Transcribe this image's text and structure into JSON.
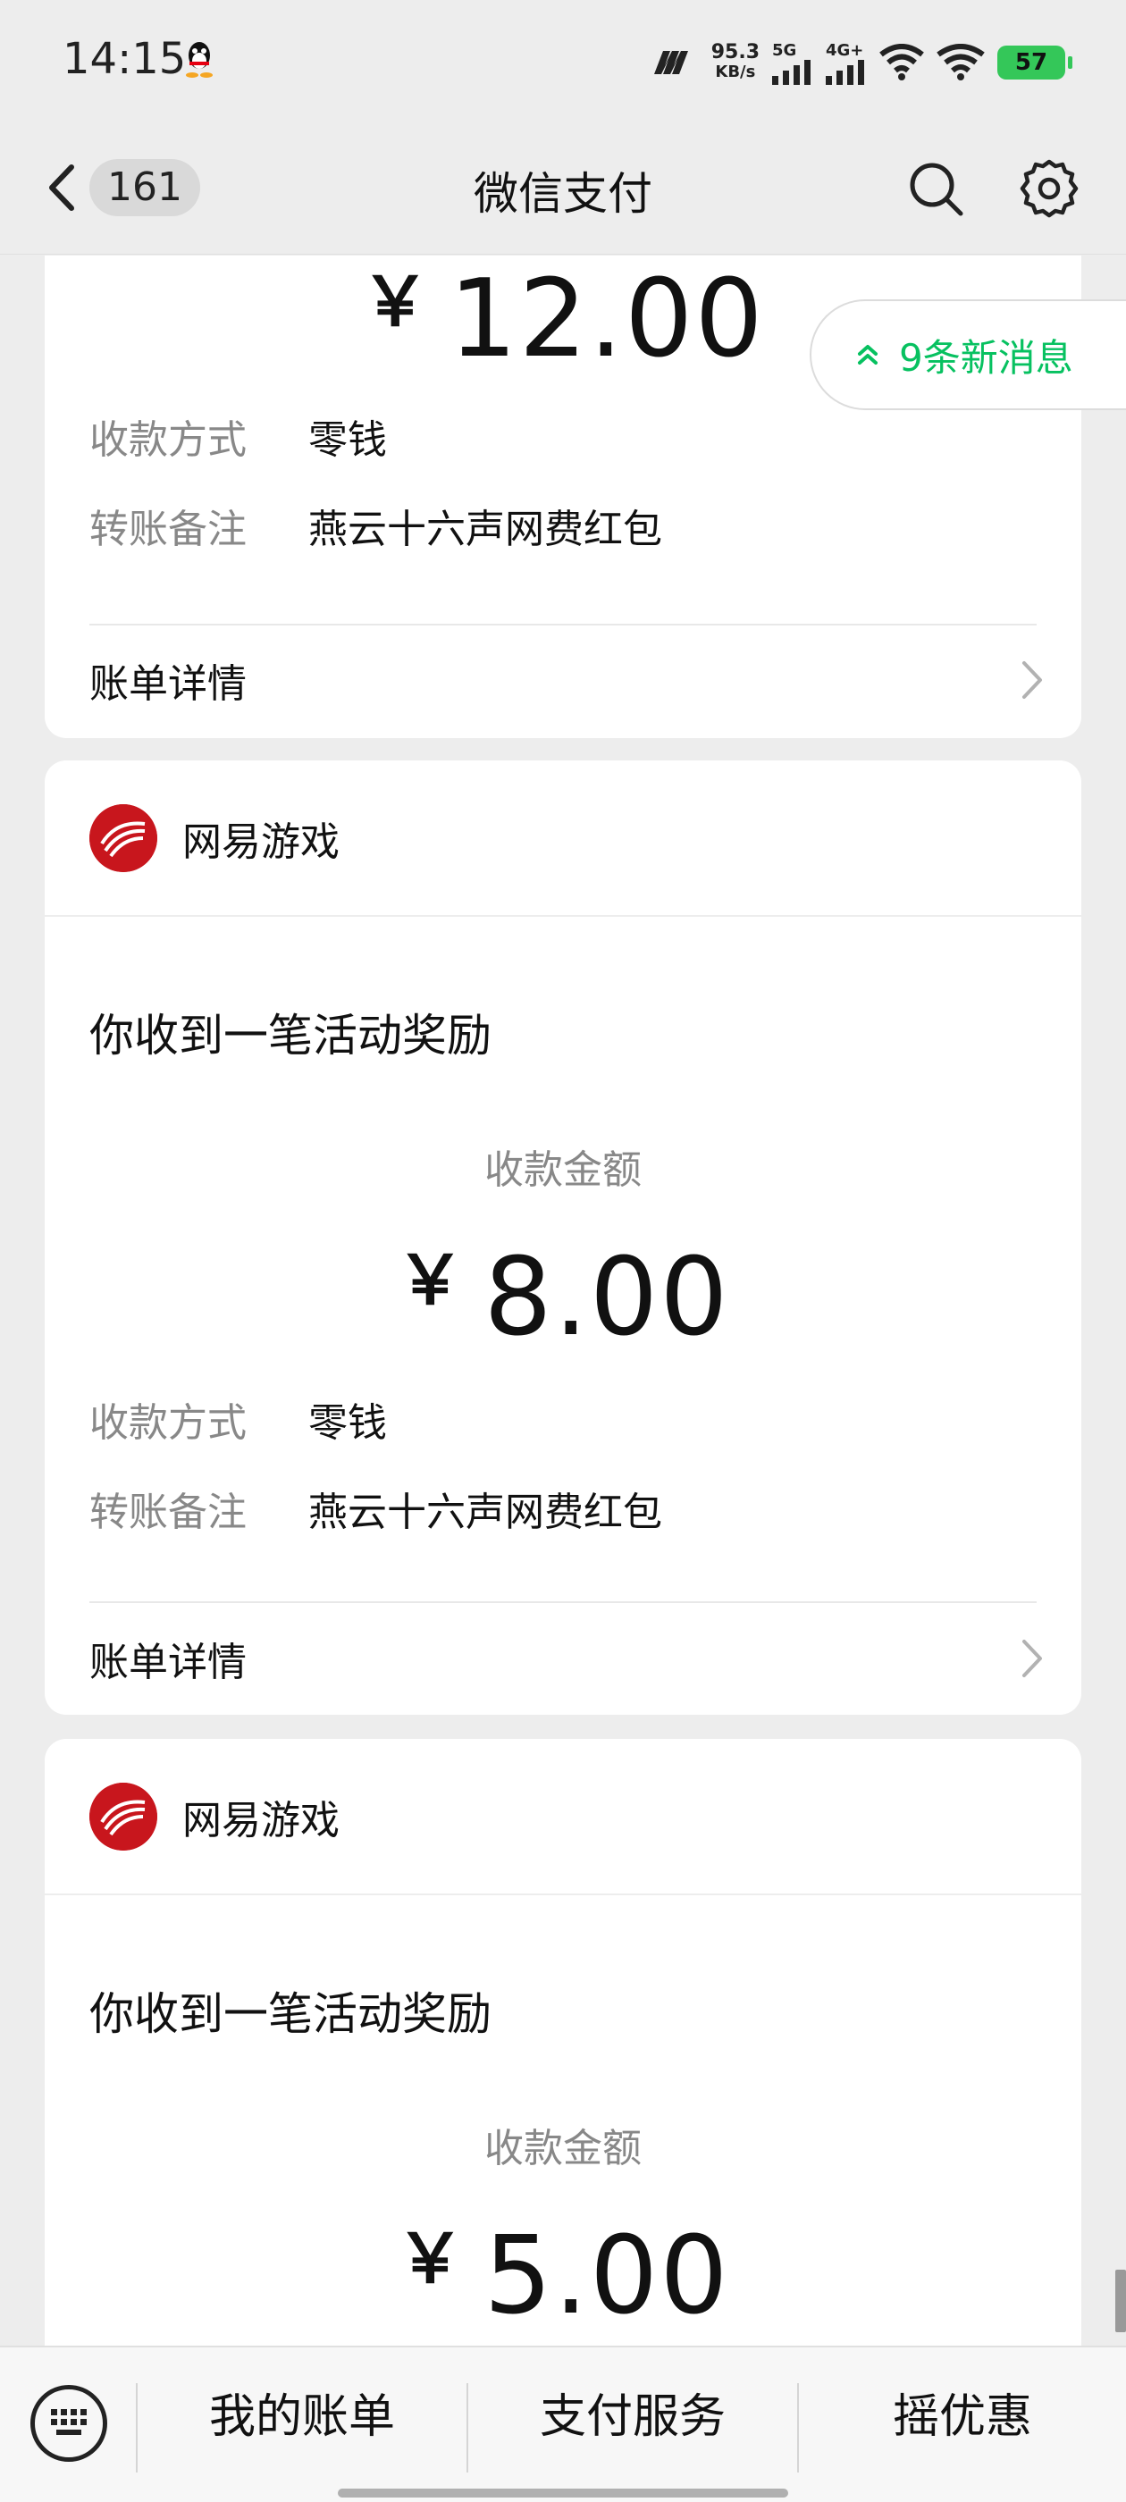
{
  "status_bar": {
    "time": "14:15",
    "net_speed_value": "95.3",
    "net_speed_unit": "KB/s",
    "signal_1_label": "5G",
    "signal_2_label": "4G+",
    "battery": "57",
    "icons": [
      "qq-penguin-icon",
      "m-logo-icon",
      "signal-icon",
      "wifi-icon",
      "battery-icon"
    ]
  },
  "nav": {
    "back_badge": "161",
    "title": "微信支付",
    "icons": [
      "back-chevron-icon",
      "search-icon",
      "gear-icon"
    ]
  },
  "new_messages": {
    "label": "9条新消息",
    "icon": "double-chevron-up-icon"
  },
  "cards": [
    {
      "amount_symbol": "￥",
      "amount_value": "12.00",
      "method_key": "收款方式",
      "method_value": "零钱",
      "remark_key": "转账备注",
      "remark_value": "燕云十六声网费红包",
      "details_label": "账单详情"
    },
    {
      "merchant": "网易游戏",
      "notice": "你收到一笔活动奖励",
      "amount_label": "收款金额",
      "amount_symbol": "￥",
      "amount_value": "8.00",
      "method_key": "收款方式",
      "method_value": "零钱",
      "remark_key": "转账备注",
      "remark_value": "燕云十六声网费红包",
      "details_label": "账单详情"
    },
    {
      "merchant": "网易游戏",
      "notice": "你收到一笔活动奖励",
      "amount_label": "收款金额",
      "amount_symbol": "￥",
      "amount_value": "5.00"
    }
  ],
  "bottom_bar": {
    "tabs": [
      "我的账单",
      "支付服务",
      "摇优惠"
    ],
    "keyboard_icon": "keyboard-icon"
  },
  "colors": {
    "accent_green": "#07c160",
    "brand_red": "#c8161d",
    "background": "#ededed"
  }
}
